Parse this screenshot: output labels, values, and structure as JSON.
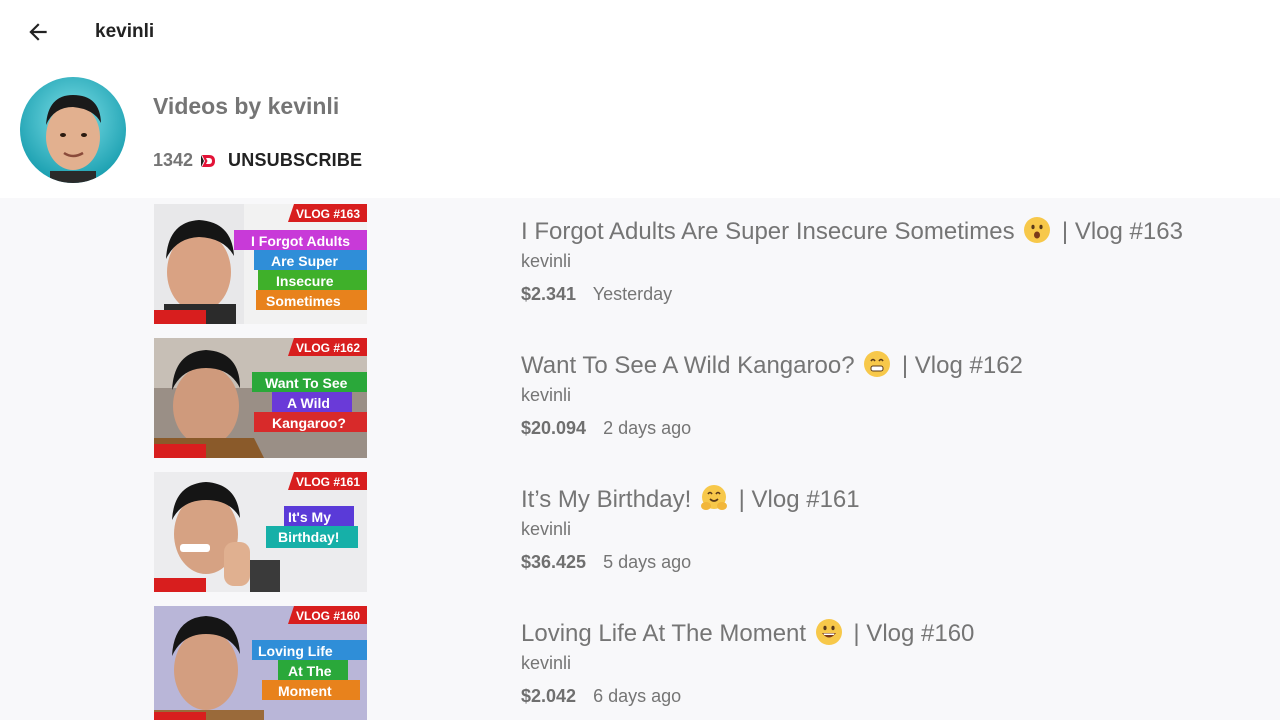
{
  "topbar": {
    "back_icon": "arrow-left-icon",
    "title": "kevinli"
  },
  "channel": {
    "title": "Videos by kevinli",
    "subscriber_count": "1342",
    "sub_logo_icon": "dtube-logo-icon",
    "unsubscribe_label": "UNSUBSCRIBE"
  },
  "videos": [
    {
      "title_text": "I Forgot Adults Are Super Insecure Sometimes",
      "emoji_icon": "surprised-face-emoji",
      "title_suffix": "| Vlog #163",
      "author": "kevinli",
      "price": "$2.341",
      "time": "Yesterday",
      "thumb_tag": "VLOG #163",
      "thumb_lines": [
        "I Forgot Adults",
        "Are Super",
        "Insecure",
        "Sometimes"
      ]
    },
    {
      "title_text": "Want To See A Wild Kangaroo?",
      "emoji_icon": "grinning-face-emoji",
      "title_suffix": "| Vlog #162",
      "author": "kevinli",
      "price": "$20.094",
      "time": "2 days ago",
      "thumb_tag": "VLOG #162",
      "thumb_lines": [
        "Want To See",
        "A Wild",
        "Kangaroo?"
      ]
    },
    {
      "title_text": "It’s My Birthday!",
      "emoji_icon": "hugging-face-emoji",
      "title_suffix": " | Vlog #161",
      "author": "kevinli",
      "price": "$36.425",
      "time": "5 days ago",
      "thumb_tag": "VLOG #161",
      "thumb_lines": [
        "It's My",
        "Birthday!"
      ]
    },
    {
      "title_text": "Loving Life At The Moment",
      "emoji_icon": "smiling-face-emoji",
      "title_suffix": "| Vlog #160",
      "author": "kevinli",
      "price": "$2.042",
      "time": "6 days ago",
      "thumb_tag": "VLOG #160",
      "thumb_lines": [
        "Loving Life",
        "At The",
        "Moment"
      ]
    }
  ],
  "colors": {
    "list_background": "#f8f8fa",
    "text_gray": "#757575",
    "thumb_tag_red": "#d81e1e"
  }
}
